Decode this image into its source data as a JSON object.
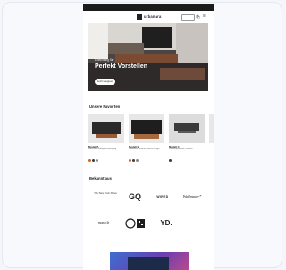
{
  "announcement": "",
  "brand": {
    "name": "urbanara"
  },
  "header": {
    "account_label": "",
    "cart_icon": "bag-icon",
    "menu_icon": "hamburger-icon"
  },
  "hero": {
    "kicker": "Einrichtung für",
    "title": "Perfekt Vorstellen",
    "button_label": "Jetzt shoppen"
  },
  "products_section": {
    "title": "Unsere Favoriten",
    "items": [
      {
        "name": "Modell A",
        "desc": "Samtcord, kompakter Boxspring",
        "colors": [
          "#c9632a",
          "#3b3b3b",
          "#8a8a8a"
        ]
      },
      {
        "name": "Modell B",
        "desc": "Sideboard, Walnuss massiv Design",
        "colors": [
          "#c9632a",
          "#3b3b3b",
          "#8a8a8a"
        ]
      },
      {
        "name": "Modell C",
        "desc": "Plattenspieler Set Premium",
        "colors": [
          "#3b3b3b"
        ]
      }
    ]
  },
  "press_section": {
    "title": "Bekannt aus",
    "logos": [
      "The New York Times",
      "GQ",
      "WIRED",
      "Wallpaper*",
      "monocle",
      "QR",
      "YD."
    ]
  }
}
